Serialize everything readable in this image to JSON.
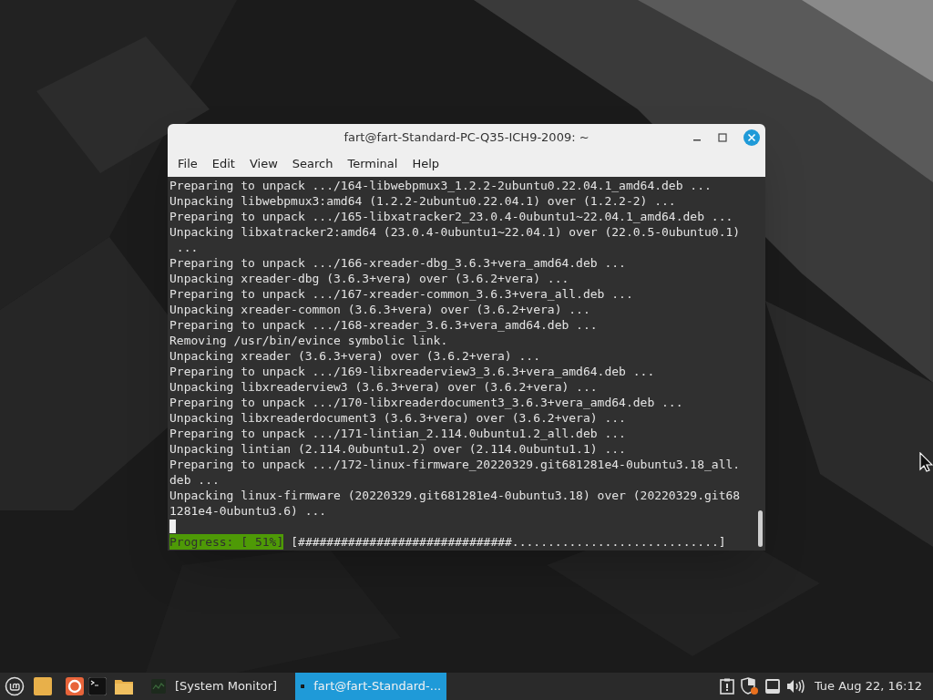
{
  "window": {
    "title": "fart@fart-Standard-PC-Q35-ICH9-2009: ~",
    "menu": [
      "File",
      "Edit",
      "View",
      "Search",
      "Terminal",
      "Help"
    ],
    "lines": [
      "Preparing to unpack .../164-libwebpmux3_1.2.2-2ubuntu0.22.04.1_amd64.deb ...",
      "Unpacking libwebpmux3:amd64 (1.2.2-2ubuntu0.22.04.1) over (1.2.2-2) ...",
      "Preparing to unpack .../165-libxatracker2_23.0.4-0ubuntu1~22.04.1_amd64.deb ...",
      "Unpacking libxatracker2:amd64 (23.0.4-0ubuntu1~22.04.1) over (22.0.5-0ubuntu0.1)",
      " ...",
      "Preparing to unpack .../166-xreader-dbg_3.6.3+vera_amd64.deb ...",
      "Unpacking xreader-dbg (3.6.3+vera) over (3.6.2+vera) ...",
      "Preparing to unpack .../167-xreader-common_3.6.3+vera_all.deb ...",
      "Unpacking xreader-common (3.6.3+vera) over (3.6.2+vera) ...",
      "Preparing to unpack .../168-xreader_3.6.3+vera_amd64.deb ...",
      "Removing /usr/bin/evince symbolic link.",
      "Unpacking xreader (3.6.3+vera) over (3.6.2+vera) ...",
      "Preparing to unpack .../169-libxreaderview3_3.6.3+vera_amd64.deb ...",
      "Unpacking libxreaderview3 (3.6.3+vera) over (3.6.2+vera) ...",
      "Preparing to unpack .../170-libxreaderdocument3_3.6.3+vera_amd64.deb ...",
      "Unpacking libxreaderdocument3 (3.6.3+vera) over (3.6.2+vera) ...",
      "Preparing to unpack .../171-lintian_2.114.0ubuntu1.2_all.deb ...",
      "Unpacking lintian (2.114.0ubuntu1.2) over (2.114.0ubuntu1.1) ...",
      "Preparing to unpack .../172-linux-firmware_20220329.git681281e4-0ubuntu3.18_all.",
      "deb ...",
      "Unpacking linux-firmware (20220329.git681281e4-0ubuntu3.18) over (20220329.git68",
      "1281e4-0ubuntu3.6) ..."
    ],
    "progress": {
      "label": "Progress: [ 51%]",
      "bar": "[##############################.............................]"
    }
  },
  "taskbar": {
    "tasks": [
      {
        "kind": "monitor",
        "label": "[System Monitor]",
        "selected": false
      },
      {
        "kind": "terminal",
        "label": "fart@fart-Standard-...",
        "selected": true
      }
    ],
    "clock": "Tue Aug 22, 16:12"
  }
}
